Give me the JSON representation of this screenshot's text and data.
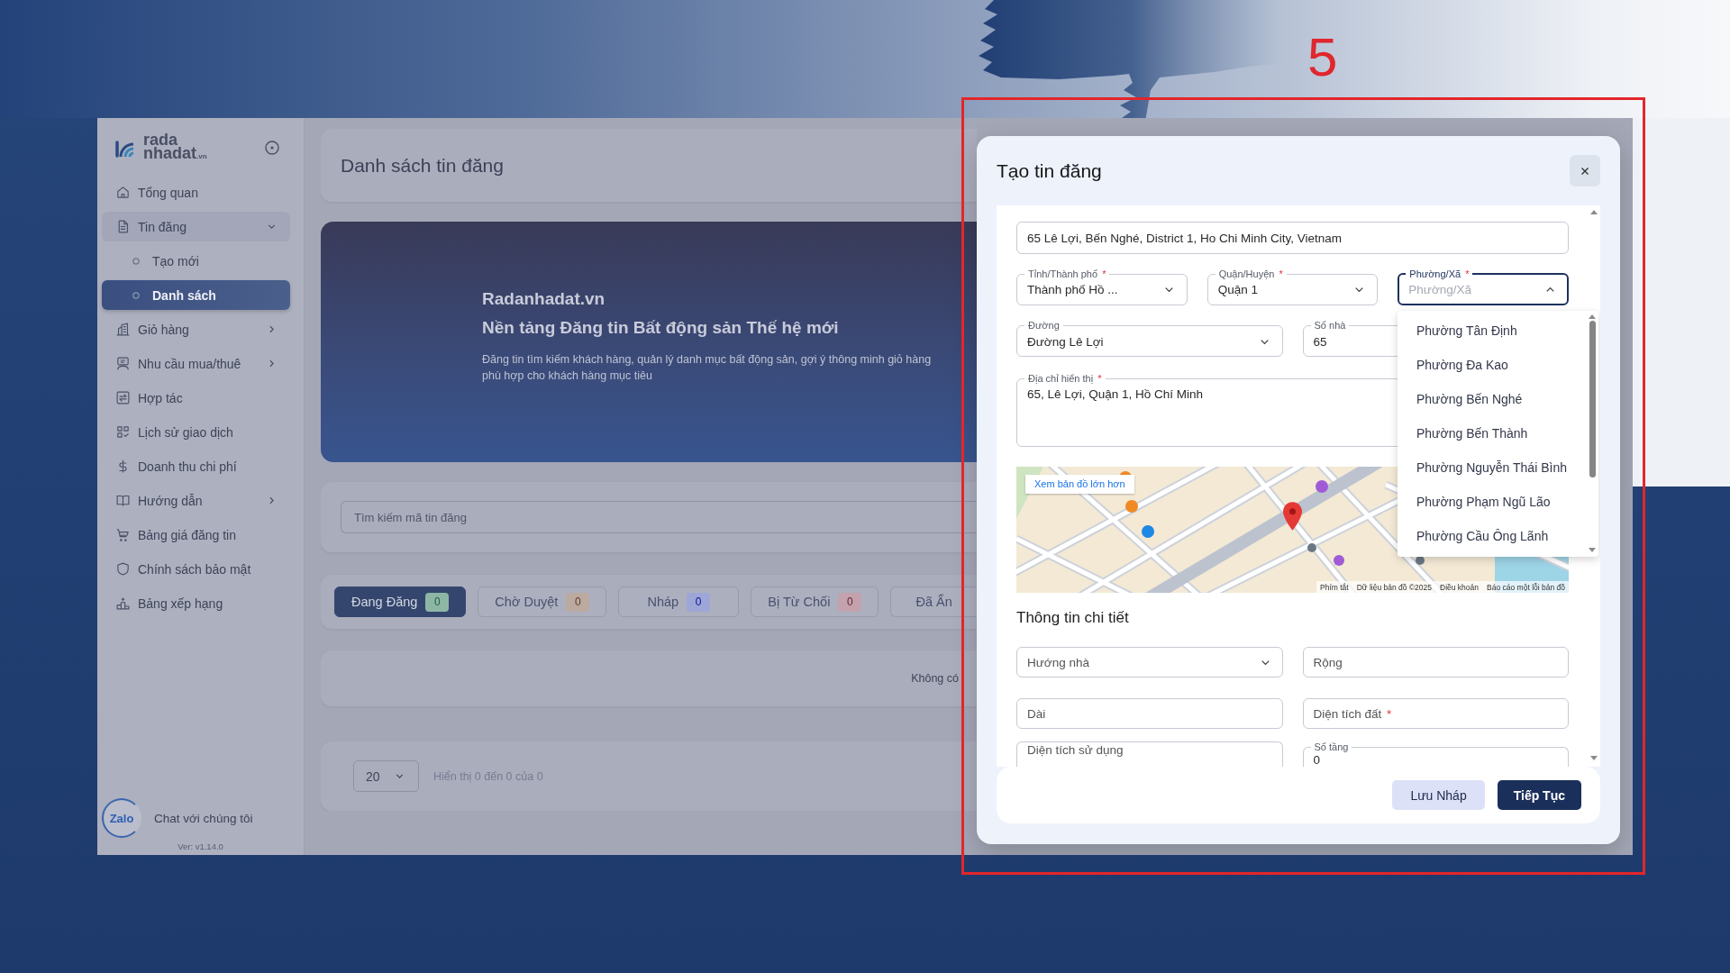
{
  "step_number": "5",
  "sidebar": {
    "logo": {
      "line1": "rada",
      "line2": "nhadat",
      "suffix": ".vn"
    },
    "items": [
      {
        "label": "Tổng quan",
        "selected": false
      },
      {
        "label": "Tin đăng",
        "selected": false,
        "expanded": true,
        "children": [
          {
            "label": "Tạo mới",
            "selected": false
          },
          {
            "label": "Danh sách",
            "selected": true
          }
        ]
      },
      {
        "label": "Giỏ hàng",
        "selected": false,
        "expanded": false
      },
      {
        "label": "Nhu cầu mua/thuê",
        "selected": false,
        "expanded": false
      },
      {
        "label": "Hợp tác",
        "selected": false
      },
      {
        "label": "Lịch sử giao dịch",
        "selected": false
      },
      {
        "label": "Doanh thu chi phí",
        "selected": false
      },
      {
        "label": "Hướng dẫn",
        "selected": false,
        "expanded": false
      },
      {
        "label": "Bảng giá đăng tin",
        "selected": false
      },
      {
        "label": "Chính sách bảo mật",
        "selected": false
      },
      {
        "label": "Bảng xếp hạng",
        "selected": false
      }
    ],
    "chat": {
      "logo_text": "Zalo",
      "label": "Chat với chúng tôi"
    },
    "version": "Ver: v1.14.0"
  },
  "page": {
    "title": "Danh sách tin đăng",
    "banner": {
      "brand": "Radanhadat.vn",
      "headline": "Nền tảng Đăng tin Bất động sản Thế hệ mới",
      "description": "Đăng tin tìm kiếm khách hàng, quản lý danh mục bất động sản, gợi ý thông minh giỏ hàng phù hợp cho khách hàng mục tiêu"
    },
    "search": {
      "placeholder": "Tìm kiếm mã tin đăng"
    },
    "status_tabs": [
      {
        "label": "Đang Đăng",
        "count": "0",
        "color": "#8db7a4",
        "selected": true
      },
      {
        "label": "Chờ Duyệt",
        "count": "0",
        "color": "#bcaaa0",
        "selected": false
      },
      {
        "label": "Nháp",
        "count": "0",
        "color": "#9ea6d8",
        "selected": false
      },
      {
        "label": "Bị Từ Chối",
        "count": "0",
        "color": "#c3a2ad",
        "selected": false
      },
      {
        "label": "Đã Ẩn",
        "selected": false
      }
    ],
    "empty_state": "Không có",
    "pagination": {
      "page_size": "20",
      "summary": "Hiển thị 0 đến 0 của 0"
    }
  },
  "modal": {
    "title": "Tạo tin đăng",
    "address_search": "65 Lê Lợi, Bến Nghé, District 1, Ho Chi Minh City, Vietnam",
    "location_fields": [
      {
        "label": "Tỉnh/Thành phố",
        "required_mark": "*",
        "value": "Thành phố Hồ ...",
        "expanded": false
      },
      {
        "label": "Quận/Huyện",
        "required_mark": "*",
        "value": "Quận 1",
        "expanded": false
      },
      {
        "label": "Phường/Xã",
        "required_mark": "*",
        "placeholder": "Phường/Xã",
        "expanded": true
      }
    ],
    "street_fields": [
      {
        "label": "Đường",
        "value": "Đường Lê Lợi",
        "expanded": false
      },
      {
        "label": "Số nhà",
        "value": "65"
      }
    ],
    "display_address": {
      "label": "Địa chỉ hiển thị",
      "required_mark": "*",
      "value": "65, Lê Lợi, Quận 1, Hồ Chí Minh"
    },
    "map": {
      "link": "Xem bản đồ lớn hơn",
      "attribution": [
        "Phím tắt",
        "Dữ liệu bản đồ ©2025",
        "Điều khoản",
        "Báo cáo một lỗi bản đồ"
      ]
    },
    "ward_options": [
      {
        "label": "Phường Tân Định",
        "selected": false
      },
      {
        "label": "Phường Đa Kao",
        "selected": false
      },
      {
        "label": "Phường Bến Nghé",
        "selected": false
      },
      {
        "label": "Phường Bến Thành",
        "selected": false
      },
      {
        "label": "Phường Nguyễn Thái Bình",
        "selected": false
      },
      {
        "label": "Phường Phạm Ngũ Lão",
        "selected": false
      },
      {
        "label": "Phường Cầu Ông Lãnh",
        "selected": false
      }
    ],
    "details": {
      "title": "Thông tin chi tiết",
      "fields": [
        {
          "placeholder": "Hướng nhà",
          "expanded": false
        },
        {
          "placeholder": "Rộng"
        },
        {
          "placeholder": "Dài"
        },
        {
          "placeholder": "Diện tích đất",
          "required_mark": "*"
        },
        {
          "placeholder": "Diện tích sử dụng"
        },
        {
          "label": "Số tầng",
          "value": "0"
        }
      ]
    },
    "buttons": [
      {
        "kind": "secondary",
        "label": "Lưu Nháp"
      },
      {
        "kind": "primary",
        "label": "Tiếp Tục"
      }
    ]
  }
}
